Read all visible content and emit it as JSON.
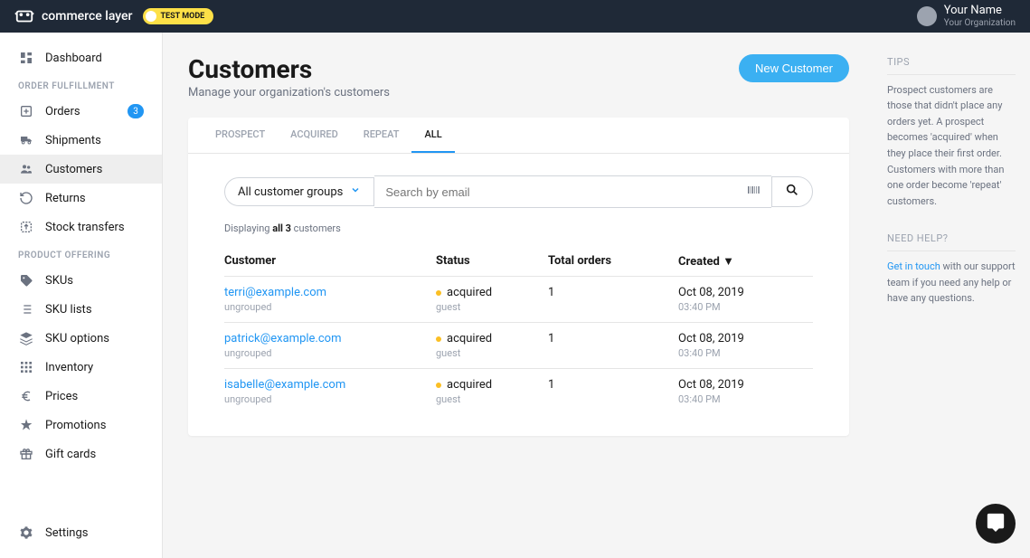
{
  "header": {
    "brand": "commerce layer",
    "test_mode": "TEST MODE",
    "user_name": "Your Name",
    "user_org": "Your Organization"
  },
  "sidebar": {
    "dashboard": "Dashboard",
    "section_orders": "ORDER FULFILLMENT",
    "orders": {
      "label": "Orders",
      "count": "3"
    },
    "shipments": "Shipments",
    "customers": "Customers",
    "returns": "Returns",
    "stock_transfers": "Stock transfers",
    "section_product": "PRODUCT OFFERING",
    "skus": "SKUs",
    "sku_lists": "SKU lists",
    "sku_options": "SKU options",
    "inventory": "Inventory",
    "prices": "Prices",
    "promotions": "Promotions",
    "gift_cards": "Gift cards",
    "settings": "Settings"
  },
  "page": {
    "title": "Customers",
    "subtitle": "Manage your organization's customers",
    "new_button": "New Customer"
  },
  "tabs": {
    "prospect": "PROSPECT",
    "acquired": "ACQUIRED",
    "repeat": "REPEAT",
    "all": "ALL"
  },
  "filters": {
    "dropdown": "All customer groups",
    "search_placeholder": "Search by email"
  },
  "displaying": {
    "prefix": "Displaying ",
    "bold": "all 3",
    "suffix": " customers"
  },
  "table": {
    "headers": {
      "customer": "Customer",
      "status": "Status",
      "orders": "Total orders",
      "created": "Created ▼"
    },
    "rows": [
      {
        "email": "terri@example.com",
        "group": "ungrouped",
        "status": "acquired",
        "role": "guest",
        "orders": "1",
        "date": "Oct 08, 2019",
        "time": "03:40 PM"
      },
      {
        "email": "patrick@example.com",
        "group": "ungrouped",
        "status": "acquired",
        "role": "guest",
        "orders": "1",
        "date": "Oct 08, 2019",
        "time": "03:40 PM"
      },
      {
        "email": "isabelle@example.com",
        "group": "ungrouped",
        "status": "acquired",
        "role": "guest",
        "orders": "1",
        "date": "Oct 08, 2019",
        "time": "03:40 PM"
      }
    ]
  },
  "tips": {
    "heading": "TIPS",
    "body": "Prospect customers are those that didn't place any orders yet. A prospect becomes 'acquired' when they place their first order. Customers with more than one order become 'repeat' customers."
  },
  "help": {
    "heading": "NEED HELP?",
    "link": "Get in touch",
    "body": " with our support team if you need any help or have any questions."
  }
}
